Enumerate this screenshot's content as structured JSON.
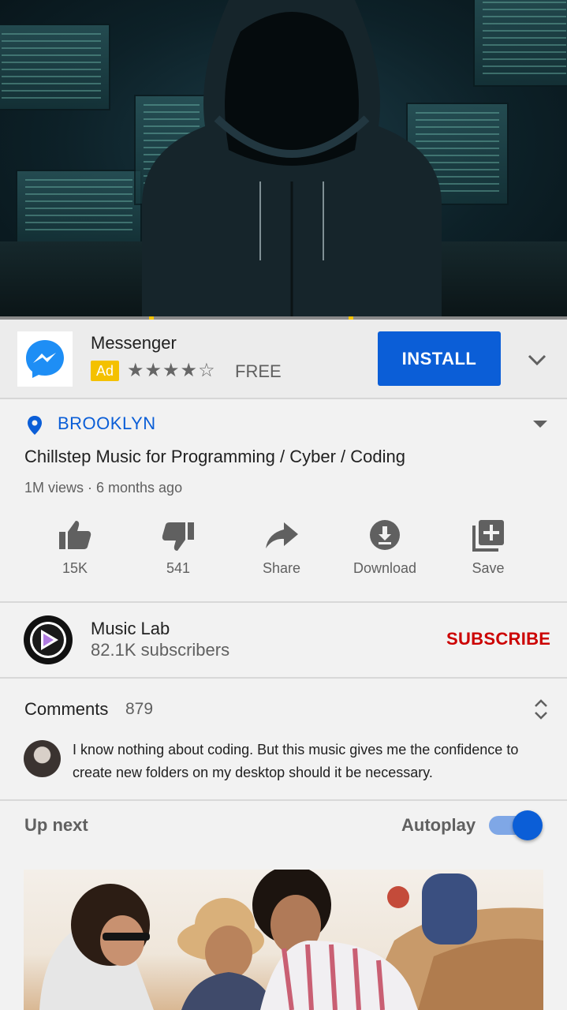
{
  "ad": {
    "app_name": "Messenger",
    "badge": "Ad",
    "stars": "★★★★☆",
    "price": "FREE",
    "install_label": "INSTALL",
    "colors": {
      "install": "#0b5ed7",
      "badge": "#f4c100",
      "messenger": "#1e8ef5"
    }
  },
  "video": {
    "location": "BROOKLYN",
    "title": "Chillstep Music for Programming / Cyber / Coding",
    "meta": "1M views · 6 months ago"
  },
  "actions": [
    {
      "label": "15K",
      "icon": "thumbs-up-icon"
    },
    {
      "label": "541",
      "icon": "thumbs-down-icon"
    },
    {
      "label": "Share",
      "icon": "share-icon"
    },
    {
      "label": "Download",
      "icon": "download-icon"
    },
    {
      "label": "Save",
      "icon": "playlist-add-icon"
    }
  ],
  "channel": {
    "name": "Music Lab",
    "subscribers": "82.1K subscribers",
    "subscribe_label": "SUBSCRIBE",
    "subscribe_color": "#cc0000"
  },
  "comments": {
    "label": "Comments",
    "count": "879",
    "top_comment": "I know nothing about coding. But this music gives me the confidence to create new folders on my desktop should it be necessary."
  },
  "up_next": {
    "label": "Up next",
    "autoplay_label": "Autoplay",
    "autoplay_on": true
  }
}
